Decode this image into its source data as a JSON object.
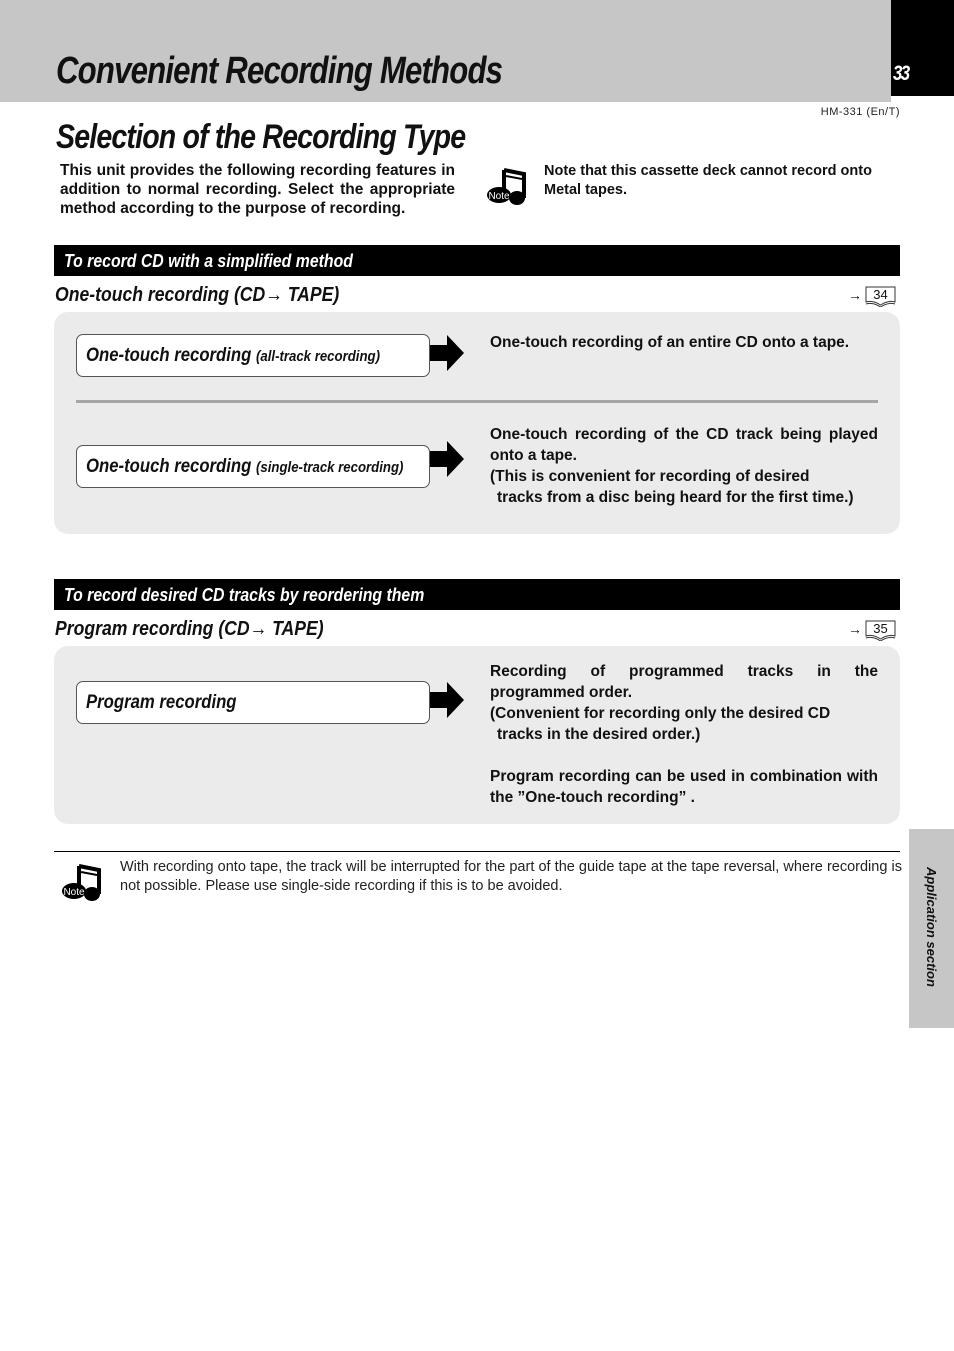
{
  "header": {
    "title": "Convenient Recording Methods",
    "page_number": "33",
    "model_code": "HM-331 (En/T)"
  },
  "section_title": "Selection of the Recording Type",
  "intro_text": "This unit provides the following recording features in addition to normal recording. Select the appropriate method according to the purpose of recording.",
  "top_note": {
    "icon_label": "Note",
    "text": "Note that this cassette deck cannot record onto Metal tapes."
  },
  "sections": [
    {
      "bar_title": "To record CD with a simplified method",
      "subheading": "One-touch recording (CD→ TAPE)",
      "ref_page": "34",
      "items": [
        {
          "label": "One-touch recording",
          "sublabel": "(all-track recording)",
          "description": "One-touch recording of an entire CD onto a tape."
        },
        {
          "label": "One-touch recording",
          "sublabel": "(single-track recording)",
          "description_lines": [
            "One-touch recording of the CD track being played onto a tape.",
            "(This is convenient for recording of desired",
            "tracks from a disc being heard for the first time.)"
          ]
        }
      ]
    },
    {
      "bar_title": "To record desired CD tracks by reordering them",
      "subheading": "Program recording (CD→ TAPE)",
      "ref_page": "35",
      "items": [
        {
          "label": "Program recording",
          "description_lines": [
            "Recording of programmed tracks in the programmed order.",
            "(Convenient for recording only the desired CD",
            "tracks in the desired order.)",
            "Program recording can be used in combination with the ”One-touch recording” ."
          ]
        }
      ]
    }
  ],
  "bottom_note": {
    "icon_label": "Note",
    "text": "With recording onto tape, the track will be interrupted for the part of the guide tape at the tape reversal, where recording is not possible. Please use single-side recording if this is to be avoided."
  },
  "side_tab_label": "Application section",
  "colors": {
    "header_band": "#c6c6c6",
    "section_bar": "#000000",
    "panel_bg": "#ebebeb",
    "divider": "#a6a6a6"
  }
}
